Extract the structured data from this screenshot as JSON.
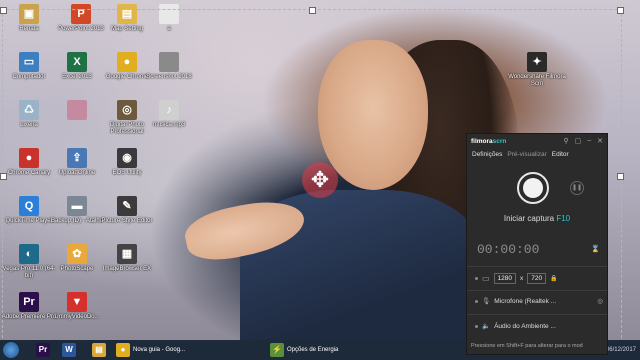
{
  "desktop_icons": [
    {
      "label": "Renata",
      "icon": "user-folder-icon",
      "color": "#c9a24b",
      "glyph": "▣"
    },
    {
      "label": "PowerPoint 2013",
      "icon": "powerpoint-icon",
      "color": "#d24726",
      "glyph": "P"
    },
    {
      "label": "Map Setting",
      "icon": "folder-icon",
      "color": "#e0b64a",
      "glyph": "▤"
    },
    {
      "label": "a",
      "icon": "document-icon",
      "color": "#e8e8e8",
      "glyph": ""
    },
    {
      "label": "Computador",
      "icon": "computer-icon",
      "color": "#3d7fc1",
      "glyph": "▭"
    },
    {
      "label": "Excel 2013",
      "icon": "excel-icon",
      "color": "#1f7244",
      "glyph": "X"
    },
    {
      "label": "Google Chrome",
      "icon": "chrome-icon",
      "color": "#e0ae1e",
      "glyph": "●"
    },
    {
      "label": "Screenshot 2018",
      "icon": "image-file-icon",
      "color": "#8a8a8a",
      "glyph": ""
    },
    {
      "label": "Wondershare Filmora Scrn",
      "icon": "filmora-scrn-icon",
      "color": "#2a2a2a",
      "glyph": "✦"
    },
    {
      "label": "Lixeira",
      "icon": "recycle-bin-icon",
      "color": "#9bb3c7",
      "glyph": "♺"
    },
    {
      "label": "",
      "icon": "profile-photo-icon",
      "color": "#c58aa0",
      "glyph": ""
    },
    {
      "label": "Digital Photo Professional",
      "icon": "photo-app-icon",
      "color": "#6d5a3e",
      "glyph": "◎"
    },
    {
      "label": "musica.mp3",
      "icon": "music-file-icon",
      "color": "#cfcfcf",
      "glyph": "♪"
    },
    {
      "label": "Chrome Canary",
      "icon": "chrome-canary-icon",
      "color": "#c9332b",
      "glyph": "●"
    },
    {
      "label": "UploadOnline",
      "icon": "upload-app-icon",
      "color": "#4a78b5",
      "glyph": "⇪"
    },
    {
      "label": "EOS Utility",
      "icon": "camera-utility-icon",
      "color": "#3a3a3a",
      "glyph": "◉"
    },
    {
      "label": "QuickTime Player",
      "icon": "quicktime-icon",
      "color": "#2c7fd8",
      "glyph": "Q"
    },
    {
      "label": "Backup (D) - Atalho",
      "icon": "drive-shortcut-icon",
      "color": "#7b8794",
      "glyph": "▬"
    },
    {
      "label": "Picture Style Editor",
      "icon": "picture-style-icon",
      "color": "#3b3b3b",
      "glyph": "✎"
    },
    {
      "label": "Vegas Pro 11.0 (64-bit)",
      "icon": "vegas-pro-icon",
      "color": "#1e6a8a",
      "glyph": "◐"
    },
    {
      "label": "PhotoScape",
      "icon": "photoscape-icon",
      "color": "#e8a93a",
      "glyph": "✿"
    },
    {
      "label": "ImageBrowser EX",
      "icon": "image-browser-icon",
      "color": "#444444",
      "glyph": "▦"
    },
    {
      "label": "Adobe Premiere Pro",
      "icon": "premiere-icon",
      "color": "#2a0f4a",
      "glyph": "Pr"
    },
    {
      "label": "UmmyVideoDo...",
      "icon": "ummy-video-icon",
      "color": "#d6302d",
      "glyph": "▼"
    }
  ],
  "taskbar": {
    "items": [
      {
        "label": "",
        "icon": "premiere-icon",
        "color": "#2a0f4a",
        "glyph": "Pr"
      },
      {
        "label": "",
        "icon": "word-icon",
        "color": "#2b579a",
        "glyph": "W"
      },
      {
        "label": "",
        "icon": "folder-icon",
        "color": "#d9a83a",
        "glyph": "▤"
      },
      {
        "label": "Nova guia - Goog...",
        "icon": "chrome-icon",
        "color": "#e0ae1e",
        "glyph": "●"
      },
      {
        "label": "Opções de Energia",
        "icon": "power-options-icon",
        "color": "#5a8f3c",
        "glyph": "⚡"
      }
    ],
    "date": "06/12/2017"
  },
  "filmora_panel": {
    "brand": "filmora",
    "brand_accent": "scrn",
    "tabs": [
      "Definições",
      "Pré-visualizar",
      "Editor"
    ],
    "capture_label": "Iniciar captura",
    "capture_key": "F10",
    "timer": "00:00:00",
    "resolution_width": "1280",
    "resolution_height": "720",
    "resolution_sep": "x",
    "microphone_label": "Microfone (Realtek ...",
    "system_audio_label": "Áudio do Ambiente ...",
    "footer": "Pressione em Shift+F para alterar para o mod"
  },
  "colors": {
    "accent": "#29c9c9",
    "taskbar": "#1c2a3a",
    "panel_bg": "#2b2b2b"
  }
}
